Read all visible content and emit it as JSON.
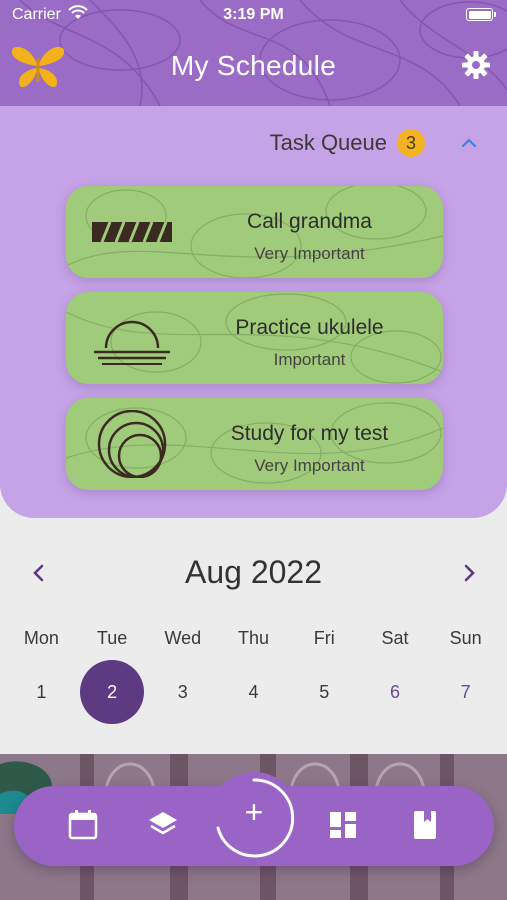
{
  "status_bar": {
    "carrier": "Carrier",
    "time": "3:19 PM"
  },
  "header": {
    "title": "My Schedule",
    "logo_icon": "butterfly-icon",
    "settings_icon": "gear-icon"
  },
  "task_queue": {
    "label": "Task Queue",
    "count": "3",
    "tasks": [
      {
        "name": "Call grandma",
        "priority": "Very Important",
        "icon": "striped-bar-icon"
      },
      {
        "name": "Practice ukulele",
        "priority": "Important",
        "icon": "sunrise-icon"
      },
      {
        "name": "Study for my test",
        "priority": "Very Important",
        "icon": "concentric-circles-icon"
      }
    ]
  },
  "calendar": {
    "month_label": "Aug 2022",
    "weekdays": [
      "Mon",
      "Tue",
      "Wed",
      "Thu",
      "Fri",
      "Sat",
      "Sun"
    ],
    "days": [
      "1",
      "2",
      "3",
      "4",
      "5",
      "6",
      "7"
    ],
    "selected_day": "2"
  },
  "nav": {
    "items": [
      "calendar-icon",
      "layers-icon",
      "add-icon",
      "dashboard-icon",
      "bookmark-icon"
    ],
    "add_label": "+"
  },
  "colors": {
    "header": "#9a6cc6",
    "queue_panel": "#c6a2e6",
    "task_card": "#9fcb7b",
    "badge": "#f3b321",
    "selected_day": "#5e3a82",
    "accent_arrow": "#3f7fe0",
    "nav": "#9a64c6"
  }
}
